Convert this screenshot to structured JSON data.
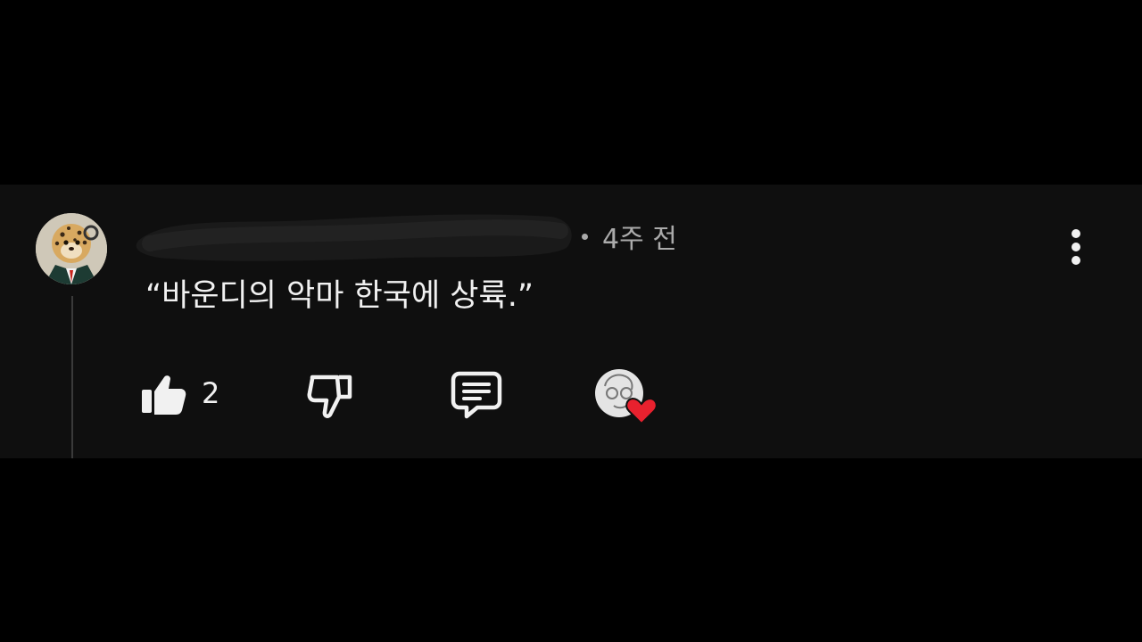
{
  "comment": {
    "timestamp": "4주 전",
    "text": "“바운디의 악마 한국에 상륙.”",
    "like_count": "2",
    "username_redacted": true
  },
  "icons": {
    "avatar": "leopard-avatar",
    "more": "vertical-dots-icon",
    "like": "thumbs-up-icon",
    "dislike": "thumbs-down-icon",
    "reply": "comment-bubble-icon",
    "creator_heart": "creator-heart-icon"
  },
  "colors": {
    "background": "#000000",
    "card": "#0f0f0f",
    "text": "#f1f1f1",
    "secondary_text": "#aaaaaa",
    "heart": "#e8212e"
  }
}
